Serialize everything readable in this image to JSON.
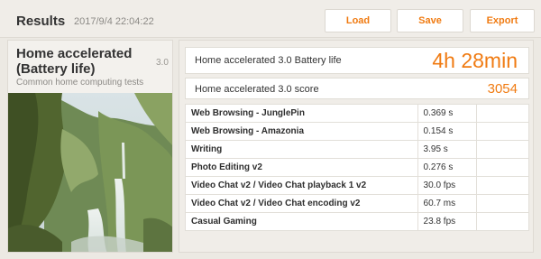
{
  "header": {
    "title": "Results",
    "timestamp": "2017/9/4 22:04:22",
    "buttons": {
      "load": "Load",
      "save": "Save",
      "export": "Export"
    }
  },
  "test": {
    "name": "Home accelerated (Battery life)",
    "version": "3.0",
    "description": "Common home computing tests"
  },
  "summary": {
    "battery_label": "Home accelerated 3.0 Battery life",
    "battery_value": "4h 28min",
    "score_label": "Home accelerated 3.0 score",
    "score_value": "3054"
  },
  "results": [
    {
      "name": "Web Browsing - JunglePin",
      "value": "0.369 s"
    },
    {
      "name": "Web Browsing - Amazonia",
      "value": "0.154 s"
    },
    {
      "name": "Writing",
      "value": "3.95 s"
    },
    {
      "name": "Photo Editing v2",
      "value": "0.276 s"
    },
    {
      "name": "Video Chat v2 / Video Chat playback 1 v2",
      "value": "30.0 fps"
    },
    {
      "name": "Video Chat v2 / Video Chat encoding v2",
      "value": "60.7 ms"
    },
    {
      "name": "Casual Gaming",
      "value": "23.8 fps"
    }
  ],
  "colors": {
    "accent": "#f07b12"
  }
}
